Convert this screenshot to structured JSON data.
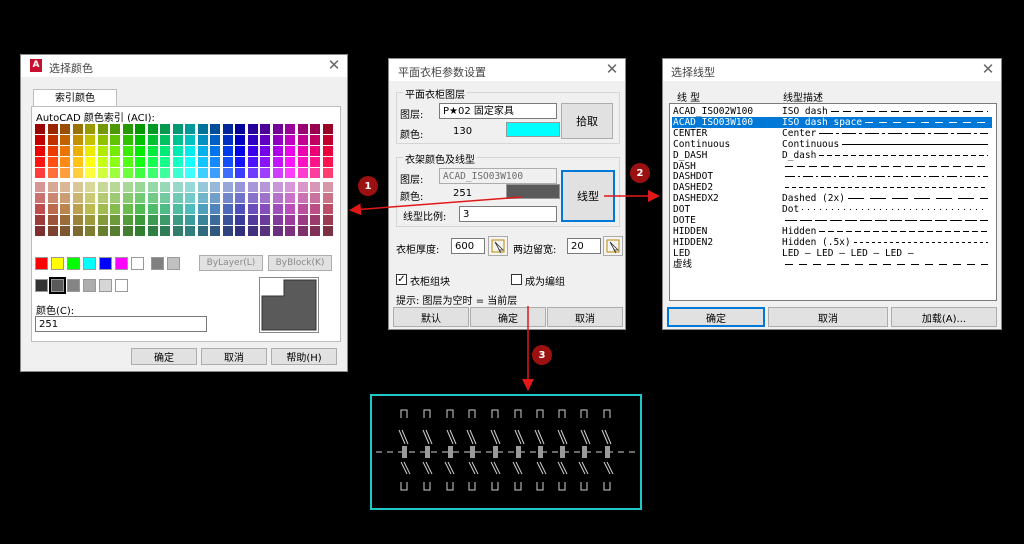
{
  "color_dialog": {
    "title": "选择颜色",
    "tab": "索引颜色",
    "aci_label": "AutoCAD 颜色索引 (ACI):",
    "bylayer": "ByLayer(L)",
    "byblock": "ByBlock(K)",
    "color_label": "颜色(C):",
    "color_value": "251",
    "ok": "确定",
    "cancel": "取消",
    "help": "帮助(H)",
    "preview_color": "#5a5a5a"
  },
  "wardrobe_dialog": {
    "title": "平面衣柜参数设置",
    "layer_group": "平面衣柜图层",
    "layer_label": "图层:",
    "layer_value": "P★02 固定家具",
    "color_label": "颜色:",
    "color_value": "130",
    "color_swatch": "#00ffff",
    "pick_button": "拾取",
    "rack_group": "衣架颜色及线型",
    "rack_layer_label": "图层:",
    "rack_layer_value": "ACAD_ISO03W100",
    "rack_color_label": "颜色:",
    "rack_color_value": "251",
    "rack_swatch": "#5a5a5a",
    "linetype_button": "线型",
    "scale_label": "线型比例:",
    "scale_value": "3",
    "thickness_label": "衣柜厚度:",
    "thickness_value": "600",
    "margin_label": "两边留宽:",
    "margin_value": "20",
    "group_checkbox": "衣柜组块",
    "group_checked": true,
    "make_group_checkbox": "成为编组",
    "make_group_checked": false,
    "hint": "提示: 图层为空时 = 当前层",
    "default_button": "默认",
    "ok": "确定",
    "cancel": "取消"
  },
  "linetype_dialog": {
    "title": "选择线型",
    "col_name": "线 型",
    "col_desc": "线型描述",
    "rows": [
      {
        "name": "ACAD_ISO02W100",
        "desc": "ISO dash"
      },
      {
        "name": "ACAD_ISO03W100",
        "desc": "ISO dash space"
      },
      {
        "name": "CENTER",
        "desc": "Center"
      },
      {
        "name": "Continuous",
        "desc": "Continuous"
      },
      {
        "name": "D_DASH",
        "desc": "D_dash"
      },
      {
        "name": "DASH",
        "desc": ""
      },
      {
        "name": "DASHDOT",
        "desc": ""
      },
      {
        "name": "DASHED2",
        "desc": ""
      },
      {
        "name": "DASHEDX2",
        "desc": "Dashed (2x)"
      },
      {
        "name": "DOT",
        "desc": "Dot"
      },
      {
        "name": "DOTE",
        "desc": ""
      },
      {
        "name": "HIDDEN",
        "desc": "Hidden"
      },
      {
        "name": "HIDDEN2",
        "desc": "Hidden (.5x)"
      },
      {
        "name": "LED",
        "desc": "LED — LED — LED — LED —"
      },
      {
        "name": "虚线",
        "desc": ""
      }
    ],
    "selected_index": 1,
    "ok": "确定",
    "cancel": "取消",
    "load": "加载(A)..."
  },
  "markers": [
    "1",
    "2",
    "3"
  ],
  "colors": {
    "accent": "#0078d7",
    "marker": "#9b1111",
    "arrow": "#e01818",
    "cad_line": "#00c8c8"
  }
}
